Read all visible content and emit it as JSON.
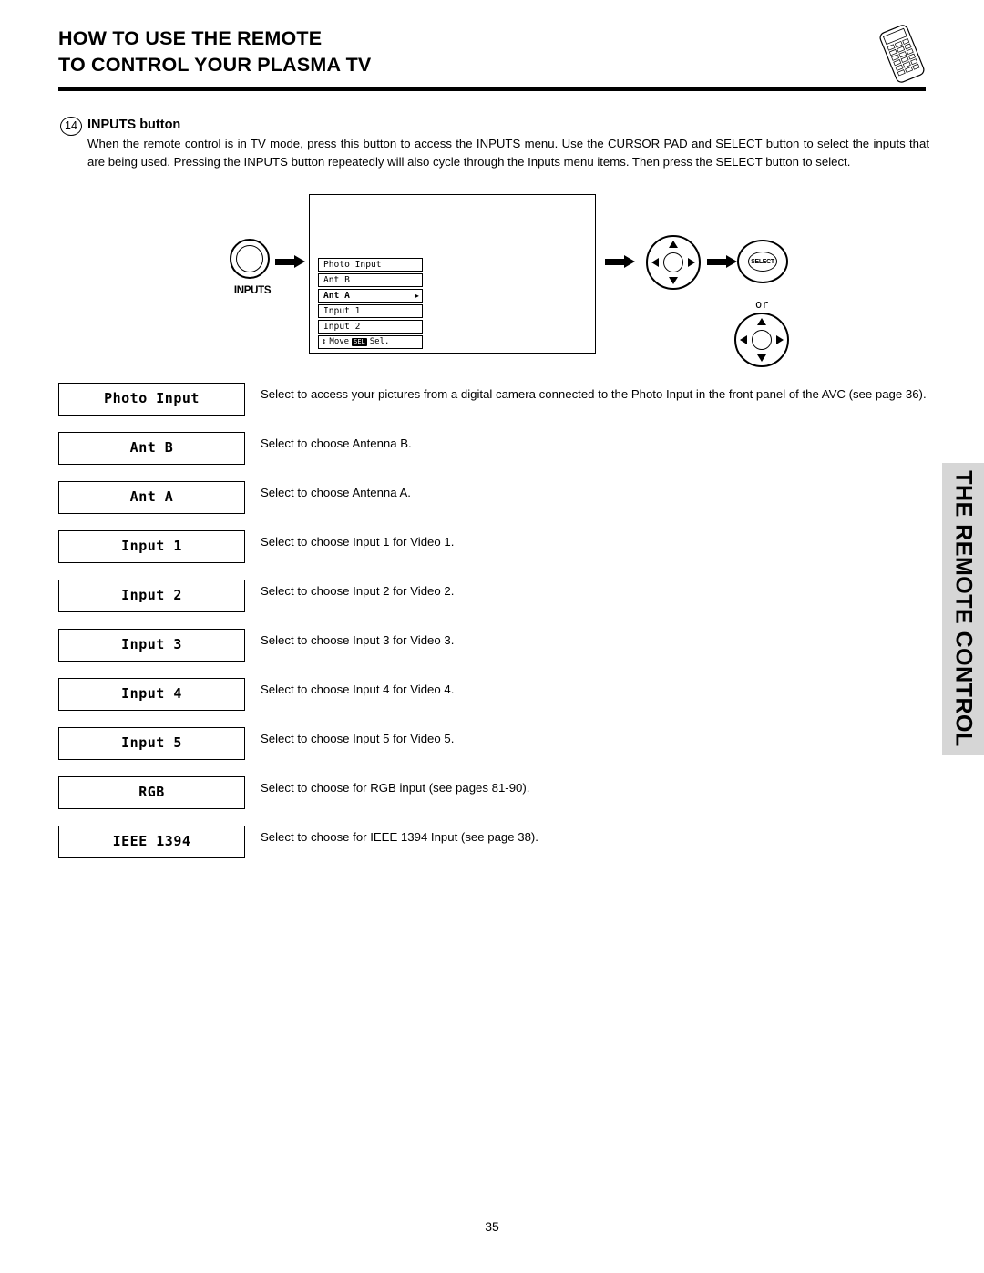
{
  "header": {
    "title_line1": "HOW TO USE THE REMOTE",
    "title_line2": "TO CONTROL YOUR PLASMA TV"
  },
  "section": {
    "number": "14",
    "title": "INPUTS button",
    "body": "When the remote control is in TV mode, press this button to access the INPUTS menu.  Use the CURSOR PAD and SELECT button to select the inputs that are being used.  Pressing the INPUTS button repeatedly will also cycle through the Inputs menu items.  Then press the SELECT button to select."
  },
  "diagram": {
    "inputs_button_label": "INPUTS",
    "select_button_label": "SELECT",
    "or_label": "or",
    "menu_items": [
      {
        "label": "Photo Input",
        "selected": false
      },
      {
        "label": "Ant B",
        "selected": false
      },
      {
        "label": "Ant A",
        "selected": true
      },
      {
        "label": "Input 1",
        "selected": false
      },
      {
        "label": "Input 2",
        "selected": false
      }
    ],
    "menu_footer": {
      "move_label": "Move",
      "key_chip": "SEL",
      "sel_label": "Sel."
    }
  },
  "definitions": [
    {
      "term": "Photo Input",
      "desc": "Select to access your pictures from a digital camera connected to the Photo Input in the front panel of the AVC (see page 36)."
    },
    {
      "term": "Ant B",
      "desc": "Select to choose Antenna B."
    },
    {
      "term": "Ant A",
      "desc": "Select to choose Antenna A."
    },
    {
      "term": "Input 1",
      "desc": "Select to choose Input 1 for Video 1."
    },
    {
      "term": "Input 2",
      "desc": "Select to choose Input 2 for Video 2."
    },
    {
      "term": "Input 3",
      "desc": "Select to choose Input 3 for Video 3."
    },
    {
      "term": "Input 4",
      "desc": "Select to choose Input 4 for Video 4."
    },
    {
      "term": "Input 5",
      "desc": "Select to choose Input 5 for Video 5."
    },
    {
      "term": "RGB",
      "desc": "Select to choose for RGB input (see pages 81-90)."
    },
    {
      "term": "IEEE 1394",
      "desc": "Select to choose for IEEE 1394 Input (see page 38)."
    }
  ],
  "side_tab": {
    "label": "THE REMOTE CONTROL"
  },
  "footer": {
    "page_number": "35"
  }
}
